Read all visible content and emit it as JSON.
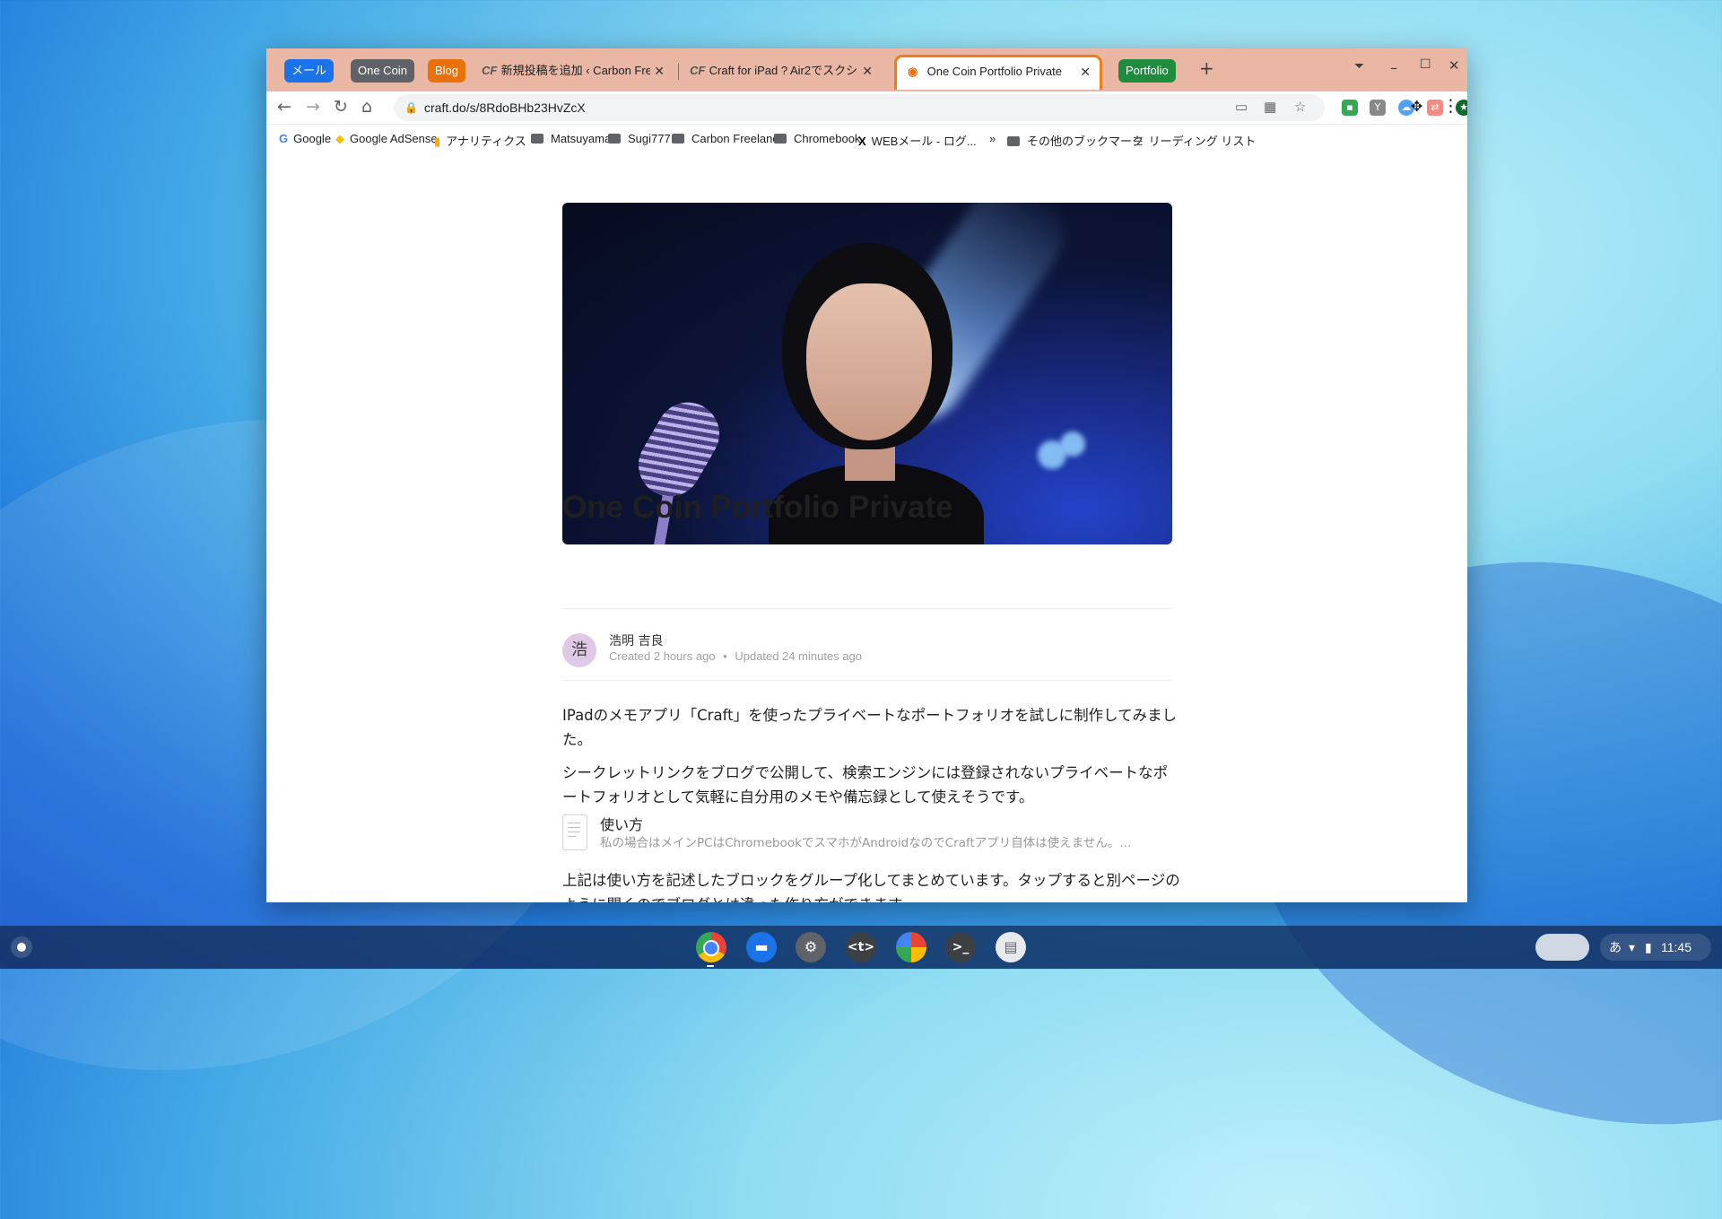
{
  "browser": {
    "tab_groups": [
      {
        "label": "メール",
        "color": "#1a73e8"
      },
      {
        "label": "One Coin",
        "color": "#5f6368"
      },
      {
        "label": "Blog",
        "color": "#e8710a"
      },
      {
        "label": "Portfolio",
        "color": "#1e8e3e"
      }
    ],
    "tabs": [
      {
        "favicon": "CF",
        "title": "新規投稿を追加 ‹ Carbon Freel",
        "close": "✕"
      },
      {
        "favicon": "CF",
        "title": "Craft for iPad ? Air2でスクシ",
        "close": "✕"
      },
      {
        "favicon": "craft-icon",
        "title": "One Coin Portfolio Private",
        "close": "✕"
      }
    ],
    "new_tab": "+",
    "address": {
      "url": "craft.do/s/8RdoBHb23HvZcX"
    },
    "bookmarks": [
      {
        "label": "Google",
        "icon": "google-icon"
      },
      {
        "label": "Google AdSense",
        "icon": "adsense-icon"
      },
      {
        "label": "アナリティクス",
        "icon": "analytics-icon"
      },
      {
        "label": "Matsuyama",
        "icon": "folder-icon"
      },
      {
        "label": "Sugi777",
        "icon": "folder-icon"
      },
      {
        "label": "Carbon Freelance",
        "icon": "folder-icon"
      },
      {
        "label": "Chromebook",
        "icon": "folder-icon"
      },
      {
        "label": "WEBメール - ログ...",
        "icon": "x-icon"
      }
    ],
    "bookmarks_overflow": "»",
    "other_bookmarks": "その他のブックマーク",
    "reading_list": "リーディング リスト"
  },
  "page": {
    "title": "One Coin Portfolio Private",
    "author": {
      "avatar_char": "浩",
      "name": "浩明 吉良"
    },
    "created": "Created 2 hours ago",
    "separator": "•",
    "updated": "Updated 24 minutes ago",
    "paragraphs": [
      "IPadのメモアプリ「Craft」を使ったプライベートなポートフォリオを試しに制作してみました。",
      "シークレットリンクをブログで公開して、検索エンジンには登録されないプライベートなポートフォリオとして気軽に自分用のメモや備忘録として使えそうです。"
    ],
    "block": {
      "title": "使い方",
      "preview": "私の場合はメインPCはChromebookでスマホがAndroidなのでCraftアプリ自体は使えません。..."
    },
    "after_block": "上記は使い方を記述したブロックをグループ化してまとめています。タップすると別ページのように開くのでブログとは違った作り方ができます。"
  },
  "shelf": {
    "apps": [
      "chrome-icon",
      "files-icon",
      "settings-icon",
      "text-editor-icon",
      "photos-icon",
      "terminal-icon",
      "screencast-icon"
    ],
    "ime": "あ",
    "time": "11:45"
  },
  "colors": {
    "tabstrip": "#e9b7a3",
    "active_tab_outline": "#ee7d17"
  }
}
